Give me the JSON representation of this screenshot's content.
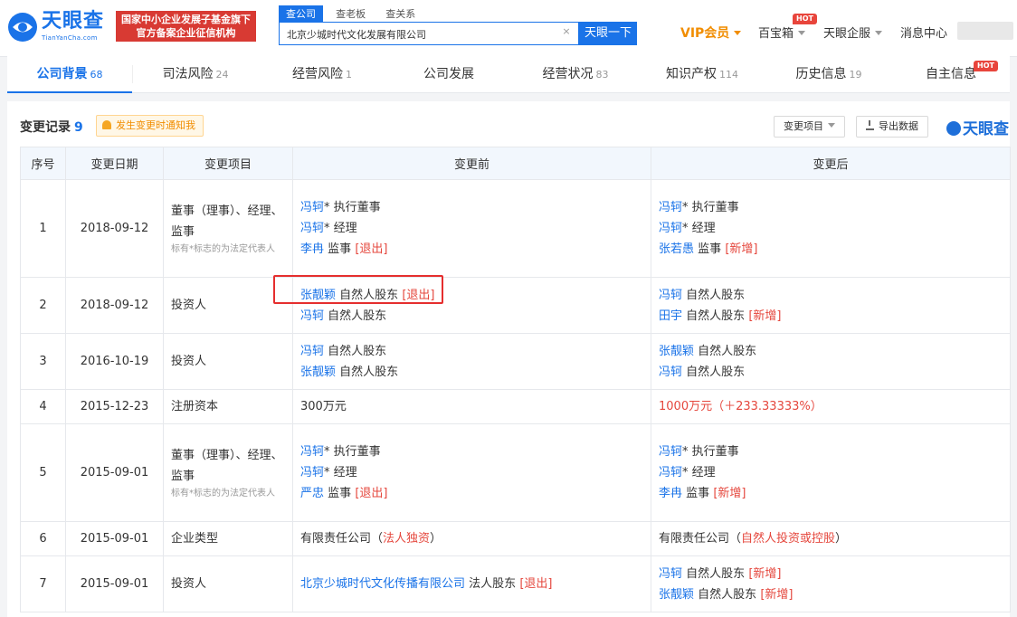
{
  "header": {
    "logo_text": "天眼查",
    "logo_sub": "TianYanCha.com",
    "banner_line1": "国家中小企业发展子基金旗下",
    "banner_line2": "官方备案企业征信机构",
    "search_tabs": [
      "查公司",
      "查老板",
      "查关系"
    ],
    "search_value": "北京少城时代文化发展有限公司",
    "search_button": "天眼一下",
    "vip": "VIP会员",
    "treasure": "百宝箱",
    "enterprise": "天眼企服",
    "messages": "消息中心",
    "hot": "HOT"
  },
  "tabs": [
    {
      "label": "公司背景",
      "count": "68"
    },
    {
      "label": "司法风险",
      "count": "24"
    },
    {
      "label": "经营风险",
      "count": "1"
    },
    {
      "label": "公司发展",
      "count": ""
    },
    {
      "label": "经营状况",
      "count": "83"
    },
    {
      "label": "知识产权",
      "count": "114"
    },
    {
      "label": "历史信息",
      "count": "19"
    },
    {
      "label": "自主信息",
      "count": ""
    }
  ],
  "section": {
    "title": "变更记录",
    "count": "9",
    "notify": "发生变更时通知我",
    "filter_button": "变更项目",
    "export_button": "导出数据",
    "watermark": "天眼查"
  },
  "table": {
    "headers": [
      "序号",
      "变更日期",
      "变更项目",
      "变更前",
      "变更后"
    ],
    "rows": [
      {
        "idx": "1",
        "date": "2018-09-12",
        "item": "董事（理事）、经理、监事",
        "note": "标有*标志的为法定代表人",
        "before": [
          {
            "name": "冯轲",
            "star": "*",
            "role": "执行董事",
            "tag": ""
          },
          {
            "name": "冯轲",
            "star": "*",
            "role": "经理",
            "tag": ""
          },
          {
            "name": "李冉",
            "star": "",
            "role": "监事",
            "tag": "[退出]"
          }
        ],
        "after": [
          {
            "name": "冯轲",
            "star": "*",
            "role": "执行董事",
            "tag": ""
          },
          {
            "name": "冯轲",
            "star": "*",
            "role": "经理",
            "tag": ""
          },
          {
            "name": "张若愚",
            "star": "",
            "role": "监事",
            "tag": "[新增]"
          }
        ]
      },
      {
        "idx": "2",
        "date": "2018-09-12",
        "item": "投资人",
        "note": "",
        "before": [
          {
            "name": "张靓颖",
            "star": "",
            "role": "自然人股东",
            "tag": "[退出]"
          },
          {
            "name": "冯轲",
            "star": "",
            "role": "自然人股东",
            "tag": ""
          }
        ],
        "after": [
          {
            "name": "冯轲",
            "star": "",
            "role": "自然人股东",
            "tag": ""
          },
          {
            "name": "田宇",
            "star": "",
            "role": "自然人股东",
            "tag": "[新增]"
          }
        ]
      },
      {
        "idx": "3",
        "date": "2016-10-19",
        "item": "投资人",
        "note": "",
        "before": [
          {
            "name": "冯轲",
            "star": "",
            "role": "自然人股东",
            "tag": ""
          },
          {
            "name": "张靓颖",
            "star": "",
            "role": "自然人股东",
            "tag": ""
          }
        ],
        "after": [
          {
            "name": "张靓颖",
            "star": "",
            "role": "自然人股东",
            "tag": ""
          },
          {
            "name": "冯轲",
            "star": "",
            "role": "自然人股东",
            "tag": ""
          }
        ]
      },
      {
        "idx": "4",
        "date": "2015-12-23",
        "item": "注册资本",
        "note": "",
        "before_text": "300万元",
        "after_text": "1000万元（＋233.33333%）"
      },
      {
        "idx": "5",
        "date": "2015-09-01",
        "item": "董事（理事）、经理、监事",
        "note": "标有*标志的为法定代表人",
        "before": [
          {
            "name": "冯轲",
            "star": "*",
            "role": "执行董事",
            "tag": ""
          },
          {
            "name": "冯轲",
            "star": "*",
            "role": "经理",
            "tag": ""
          },
          {
            "name": "严忠",
            "star": "",
            "role": "监事",
            "tag": "[退出]"
          }
        ],
        "after": [
          {
            "name": "冯轲",
            "star": "*",
            "role": "执行董事",
            "tag": ""
          },
          {
            "name": "冯轲",
            "star": "*",
            "role": "经理",
            "tag": ""
          },
          {
            "name": "李冉",
            "star": "",
            "role": "监事",
            "tag": "[新增]"
          }
        ]
      },
      {
        "idx": "6",
        "date": "2015-09-01",
        "item": "企业类型",
        "note": "",
        "before_type": {
          "main": "有限责任公司（",
          "sub": "法人独资",
          "close": "）"
        },
        "after_type": {
          "main": "有限责任公司（",
          "sub": "自然人投资或控股",
          "close": "）"
        }
      },
      {
        "idx": "7",
        "date": "2015-09-01",
        "item": "投资人",
        "note": "",
        "before": [
          {
            "name": "北京少城时代文化传播有限公司",
            "star": "",
            "role": "法人股东",
            "tag": "[退出]"
          }
        ],
        "after": [
          {
            "name": "冯轲",
            "star": "",
            "role": "自然人股东",
            "tag": "[新增]"
          },
          {
            "name": "张靓颖",
            "star": "",
            "role": "自然人股东",
            "tag": "[新增]"
          }
        ]
      }
    ]
  },
  "colors": {
    "primary": "#1a73e8",
    "danger": "#e5473d",
    "vip": "#f18d00",
    "banner": "#d83a33"
  }
}
